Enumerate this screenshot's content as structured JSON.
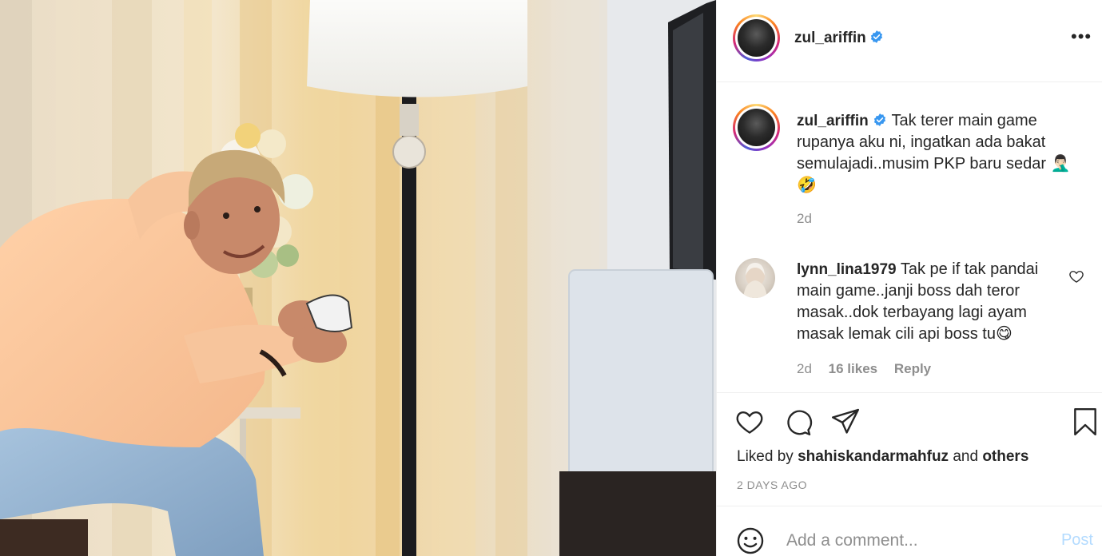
{
  "post": {
    "username": "zul_ariffin",
    "caption": "Tak terer main game rupanya aku ni, ingatkan ada bakat semulajadi..musim PKP baru sedar 🤦🏻‍♂️ 🤣",
    "time": "2d"
  },
  "comment": {
    "username": "lynn_lina1979",
    "text": "Tak pe if tak pandai main game..janji boss dah teror masak..dok terbayang lagi ayam masak lemak cili api boss tu😋",
    "time": "2d",
    "likes": "16 likes",
    "reply_label": "Reply"
  },
  "actions": {
    "liked_by_prefix": "Liked by",
    "liked_by_user": "shahiskandarmahfuz",
    "liked_by_and": "and",
    "liked_by_others": "others",
    "date": "2 DAYS AGO"
  },
  "add_comment": {
    "placeholder": "Add a comment...",
    "post_label": "Post"
  },
  "icons": {
    "more": "more-options-icon",
    "verified": "verified-badge-icon",
    "heart": "heart-icon",
    "comment": "comment-icon",
    "share": "share-icon",
    "save": "bookmark-icon",
    "emoji": "emoji-icon"
  },
  "colors": {
    "verified": "#3897f0",
    "text": "#262626",
    "muted": "#8e8e8e",
    "post_disabled": "#b3dbff"
  }
}
